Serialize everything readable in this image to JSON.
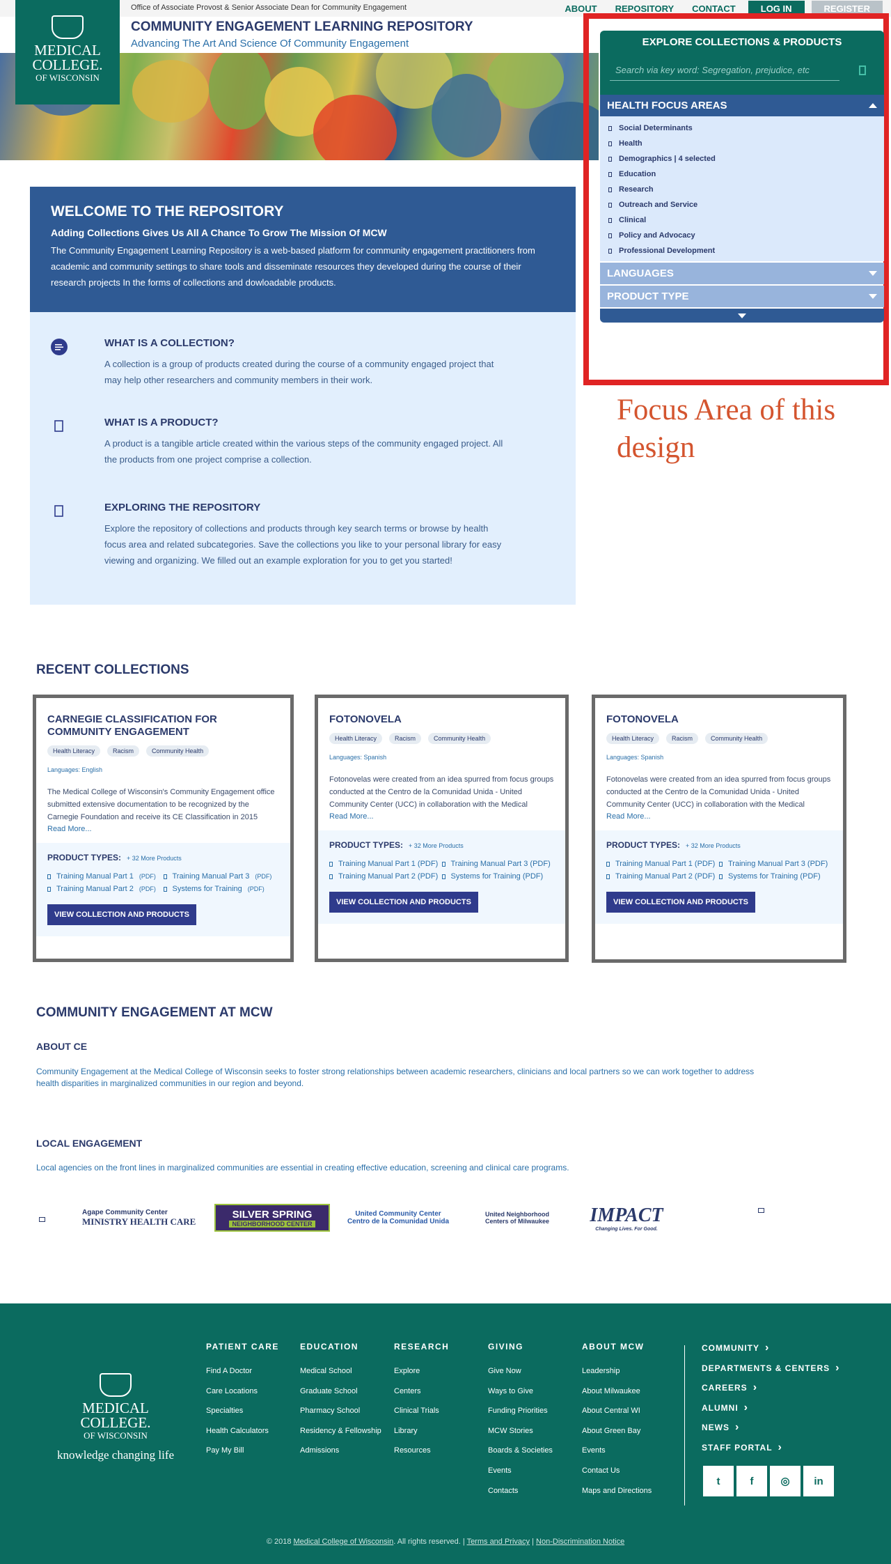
{
  "header": {
    "office": "Office of Associate Provost & Senior Associate Dean for Community Engagement",
    "title": "COMMUNITY ENGAGEMENT LEARNING REPOSITORY",
    "subtitle": "Advancing The Art And Science Of Community Engagement",
    "nav": {
      "about": "ABOUT",
      "repository": "REPOSITORY",
      "contact": "CONTACT",
      "login": "LOG IN",
      "register": "REGISTER"
    },
    "logo": {
      "line1": "MEDICAL",
      "line2": "COLLEGE.",
      "line3": "OF WISCONSIN"
    }
  },
  "explore": {
    "title": "EXPLORE COLLECTIONS & PRODUCTS",
    "search_placeholder": "Search via key word: Segregation, prejudice, etc",
    "health_focus": {
      "label": "HEALTH FOCUS AREAS",
      "items": [
        "Social Determinants",
        "Health",
        "Demographics | 4 selected",
        "Education",
        "Research",
        "Outreach and Service",
        "Clinical",
        "Policy and Advocacy",
        "Professional Development"
      ]
    },
    "languages": "LANGUAGES",
    "product_type": "PRODUCT TYPE"
  },
  "annotation": "Focus Area of this design",
  "welcome": {
    "title": "WELCOME TO  THE REPOSITORY",
    "subtitle": "Adding Collections Gives Us All A Chance To Grow The Mission Of MCW",
    "body": "The Community Engagement Learning Repository is a web-based platform for community engagement practitioners from academic and community settings to share tools and disseminate resources they developed during the course of their research projects In the forms of collections and dowloadable products."
  },
  "info": [
    {
      "title": "WHAT IS A COLLECTION?",
      "text": "A collection is a group of products created during the course of a community engaged project that may help other researchers and community members in their work."
    },
    {
      "title": "WHAT IS A PRODUCT?",
      "text": "A product is a tangible article created within the various steps of the community engaged project. All the products from one project comprise a collection."
    },
    {
      "title": "EXPLORING THE REPOSITORY",
      "text": "Explore the repository of collections and products through key search terms or browse by health focus area and related subcategories. Save the collections you like to your personal library for easy viewing and organizing. We filled out an example exploration for you to get you started!"
    }
  ],
  "recent": {
    "title": "RECENT COLLECTIONS",
    "cards": [
      {
        "title": "CARNEGIE CLASSIFICATION FOR COMMUNITY ENGAGEMENT",
        "tags": [
          "Health Literacy",
          "Racism",
          "Community Health"
        ],
        "languages": "Languages: English",
        "desc": "The Medical College of Wisconsin's Community Engagement office submitted extensive documentation to be recognized by the Carnegie Foundation and receive its CE Classification in 2015",
        "read_more": "Read More...",
        "types_label": "PRODUCT TYPES:",
        "more": "+ 32 More Products",
        "products": [
          "Training Manual Part 1",
          "Training Manual Part 3",
          "Training Manual Part 2",
          "Systems for Training"
        ],
        "pdf": "(PDF)",
        "button": "VIEW COLLECTION AND PRODUCTS"
      },
      {
        "title": "FOTONOVELA",
        "tags": [
          "Health Literacy",
          "Racism",
          "Community Health"
        ],
        "languages": "Languages: Spanish",
        "desc": "Fotonovelas were created from an idea spurred from focus groups conducted at the Centro de la Comunidad Unida - United Community Center (UCC) in collaboration with the Medical",
        "read_more": "Read More...",
        "types_label": "PRODUCT TYPES:",
        "more": "+ 32 More Products",
        "products": [
          "Training Manual Part 1 (PDF)",
          "Training Manual Part 3 (PDF)",
          "Training Manual Part 2 (PDF)",
          "Systems for Training (PDF)"
        ],
        "pdf": "",
        "button": "VIEW COLLECTION AND PRODUCTS"
      },
      {
        "title": "FOTONOVELA",
        "tags": [
          "Health Literacy",
          "Racism",
          "Community Health"
        ],
        "languages": "Languages: Spanish",
        "desc": "Fotonovelas were created from an idea spurred from focus groups conducted at the Centro de la Comunidad Unida - United Community Center (UCC) in collaboration with the Medical",
        "read_more": "Read More...",
        "types_label": "PRODUCT TYPES:",
        "more": "+ 32 More Products",
        "products": [
          "Training Manual Part 1 (PDF)",
          "Training Manual Part 3 (PDF)",
          "Training Manual Part 2 (PDF)",
          "Systems for Training (PDF)"
        ],
        "pdf": "",
        "button": "VIEW COLLECTION AND PRODUCTS"
      }
    ]
  },
  "community": {
    "title": "COMMUNITY ENGAGEMENT AT MCW",
    "about_title": "ABOUT CE",
    "about_text": "Community Engagement at the Medical College of Wisconsin seeks to foster strong relationships between academic researchers, clinicians and local partners so we can work together to address health disparities in marginalized communities in our region and beyond.",
    "local_title": "LOCAL ENGAGEMENT",
    "local_text": "Local agencies on the front lines in marginalized communities are essential in creating effective education, screening and clinical care programs.",
    "partners": [
      {
        "line1": "Agape Community Center",
        "line2": "MINISTRY HEALTH CARE"
      },
      {
        "line1": "SILVER SPRING",
        "line2": "NEIGHBORHOOD CENTER"
      },
      {
        "line1": "United Community Center",
        "line2": "Centro de la Comunidad Unida"
      },
      {
        "line1": "United Neighborhood",
        "line2": "Centers of Milwaukee"
      },
      {
        "line1": "IMPACT",
        "line2": "Changing Lives. For Good."
      }
    ]
  },
  "footer": {
    "logo": {
      "line1": "MEDICAL",
      "line2": "COLLEGE.",
      "line3": "OF WISCONSIN",
      "tagline": "knowledge changing life"
    },
    "columns": [
      {
        "title": "PATIENT CARE",
        "links": [
          "Find A Doctor",
          "Care Locations",
          "Specialties",
          "Health Calculators",
          "Pay My Bill"
        ]
      },
      {
        "title": "EDUCATION",
        "links": [
          "Medical School",
          "Graduate School",
          "Pharmacy School",
          "Residency & Fellowship",
          "Admissions"
        ]
      },
      {
        "title": "RESEARCH",
        "links": [
          "Explore",
          "Centers",
          "Clinical Trials",
          "Library",
          "Resources"
        ]
      },
      {
        "title": "GIVING",
        "links": [
          "Give Now",
          "Ways to Give",
          "Funding Priorities",
          "MCW Stories",
          "Boards & Societies",
          "Events",
          "Contacts"
        ]
      },
      {
        "title": "ABOUT MCW",
        "links": [
          "Leadership",
          "About Milwaukee",
          "About Central WI",
          "About Green Bay",
          "Events",
          "Contact Us",
          "Maps and Directions"
        ]
      }
    ],
    "side_links": [
      "COMMUNITY",
      "DEPARTMENTS & CENTERS",
      "CAREERS",
      "ALUMNI",
      "NEWS",
      "STAFF PORTAL"
    ],
    "socials": [
      "twitter",
      "facebook",
      "instagram",
      "linkedin"
    ],
    "copyright_prefix": "© 2018",
    "copyright_org": "Medical College of Wisconsin",
    "copyright_rights": ".  All rights reserved.  |",
    "terms": "Terms and Privacy",
    "sep": "|",
    "nondiscrimination": "Non-Discrimination Notice"
  }
}
